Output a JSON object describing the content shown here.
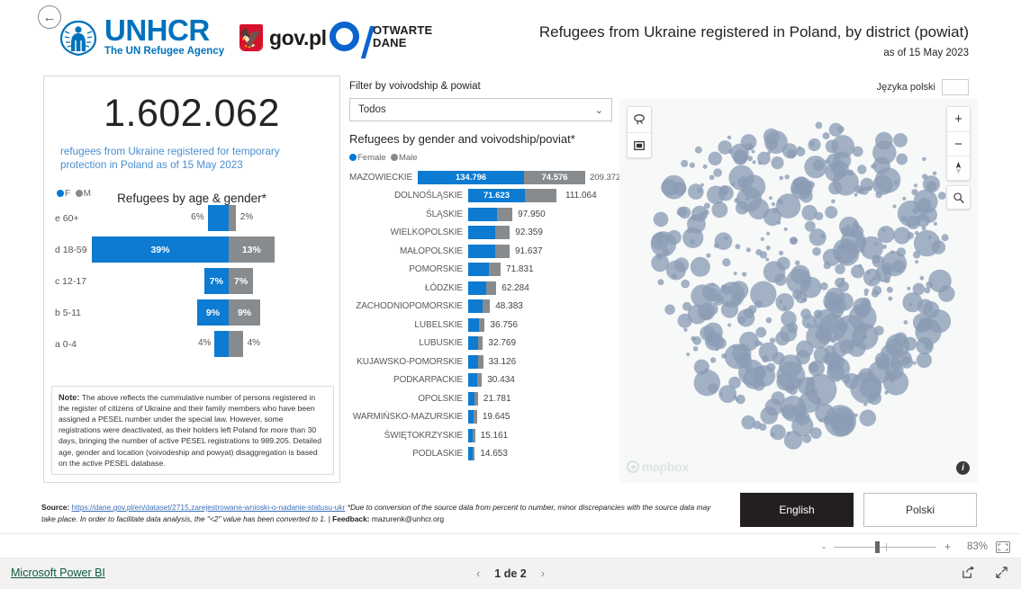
{
  "header": {
    "back_label": "←",
    "unhcr_name": "UNHCR",
    "unhcr_tagline": "The UN Refugee Agency",
    "govpl_label": "gov.pl",
    "otwarte_line1": "OTWARTE",
    "otwarte_line2": "DANE",
    "title": "Refugees from Ukraine registered in Poland, by district (powiat)",
    "as_of": "as of 15 May 2023"
  },
  "kpi": {
    "value": "1.602.062",
    "caption": "refugees from Ukraine registered for temporary protection in Poland as of 15 May 2023"
  },
  "age_chart": {
    "title": "Refugees by age & gender*",
    "legend_female": "F",
    "legend_male": "M"
  },
  "note": {
    "title": "Note:",
    "body": "The above reflects the cummulative number of persons registered in the register of citizens of Ukraine and their family members who have been assigned a PESEL number under the special law. However, some registrations were deactivated, as their holders left Poland for more than 30 days, bringing the number of active PESEL registrations to 989.205. Detailed age, gender and location (voivodeship and powyat) disaggregation is based on the active PESEL database."
  },
  "filter": {
    "label": "Filter by voivodship & powiat",
    "value": "Todos",
    "chevron": "⌄"
  },
  "mid": {
    "title": "Refugees by gender and voivodship/poviat*",
    "legend_female": "Female",
    "legend_male": "Male"
  },
  "map": {
    "tool_lasso": "lasso-select",
    "tool_box": "box-select",
    "zoom_in": "+",
    "zoom_out": "−",
    "compass": "compass",
    "search": "search",
    "attribution": "mapbox",
    "info": "i"
  },
  "lang_indicator": {
    "text": "Języka polski"
  },
  "footer": {
    "source_prefix": "Source:",
    "source_url": "https://dane.gov.pl/en/dataset/2715,zarejestrowane-wnioski-o-nadanie-statusu-ukr",
    "source_note": "*Due to conversion of the source data from percent to number, minor discrepancies with the source data may take place. In order to facilitate data analysis, the \"<2\" value has been converted to 1. |",
    "feedback_label": "Feedback:",
    "feedback_email": "mazurenk@unhcr.org",
    "btn_english": "English",
    "btn_polski": "Polski"
  },
  "zoombar": {
    "minus": "-",
    "plus": "+",
    "percent": "83%",
    "fit_label": "fit-to-page"
  },
  "bottombar": {
    "brand": "Microsoft Power BI",
    "prev": "‹",
    "next": "›",
    "page_label": "1 de 2",
    "share_icon": "share-icon",
    "fullscreen_icon": "fullscreen-icon"
  },
  "chart_data": [
    {
      "type": "bar",
      "title": "Refugees by age & gender*",
      "orientation": "horizontal-diverging",
      "categories": [
        "e 60+",
        "d 18-59",
        "c 12-17",
        "b 5-11",
        "a 0-4"
      ],
      "unit": "percent",
      "series": [
        {
          "name": "F",
          "color": "#0c7bd1",
          "values": [
            6,
            39,
            7,
            9,
            4
          ],
          "labels": [
            "6%",
            "39%",
            "7%",
            "9%",
            "4%"
          ]
        },
        {
          "name": "M",
          "color": "#888b8e",
          "values": [
            2,
            13,
            7,
            9,
            4
          ],
          "labels": [
            "2%",
            "13%",
            "7%",
            "9%",
            "4%"
          ]
        }
      ],
      "legend_position": "top-left",
      "grid": false
    },
    {
      "type": "bar",
      "title": "Refugees by gender and voivodship/poviat*",
      "orientation": "horizontal-stacked",
      "xlabel": "",
      "ylabel": "",
      "categories": [
        "MAZOWIECKIE",
        "DOLNOŚLĄSKIE",
        "ŚLĄSKIE",
        "WIELKOPOLSKIE",
        "MAŁOPOLSKIE",
        "POMORSKIE",
        "ŁÓDZKIE",
        "ZACHODNIOPOMORSKIE",
        "LUBELSKIE",
        "LUBUSKIE",
        "KUJAWSKO-POMORSKIE",
        "PODKARPACKIE",
        "OPOLSKIE",
        "WARMIŃSKO-MAZURSKIE",
        "ŚWIĘTOKRZYSKIE",
        "PODLASKIE"
      ],
      "totals": [
        "209.372",
        "111.064",
        "97.950",
        "92.359",
        "91.637",
        "71.831",
        "62.284",
        "48.383",
        "36.756",
        "32.769",
        "33.126",
        "30.434",
        "21.781",
        "19.645",
        "15.161",
        "14.653"
      ],
      "total_values": [
        209372,
        111064,
        97950,
        92359,
        91637,
        71831,
        62284,
        48383,
        36756,
        32769,
        33126,
        30434,
        21781,
        19645,
        15161,
        14653
      ],
      "series": [
        {
          "name": "Female",
          "color": "#0c7bd1",
          "values": [
            134796,
            71623,
            null,
            null,
            null,
            null,
            null,
            null,
            null,
            null,
            null,
            null,
            null,
            null,
            null,
            null
          ],
          "labels": [
            "134.796",
            "71.623",
            "",
            "",
            "",
            "",
            "",
            "",
            "",
            "",
            "",
            "",
            "",
            "",
            "",
            ""
          ]
        },
        {
          "name": "Male",
          "color": "#888b8e",
          "values": [
            74576,
            null,
            null,
            null,
            null,
            null,
            null,
            null,
            null,
            null,
            null,
            null,
            null,
            null,
            null,
            null
          ],
          "labels": [
            "74.576",
            "",
            "",
            "",
            "",
            "",
            "",
            "",
            "",
            "",
            "",
            "",
            "",
            "",
            "",
            ""
          ]
        }
      ],
      "legend_position": "top-left",
      "grid": false
    }
  ]
}
